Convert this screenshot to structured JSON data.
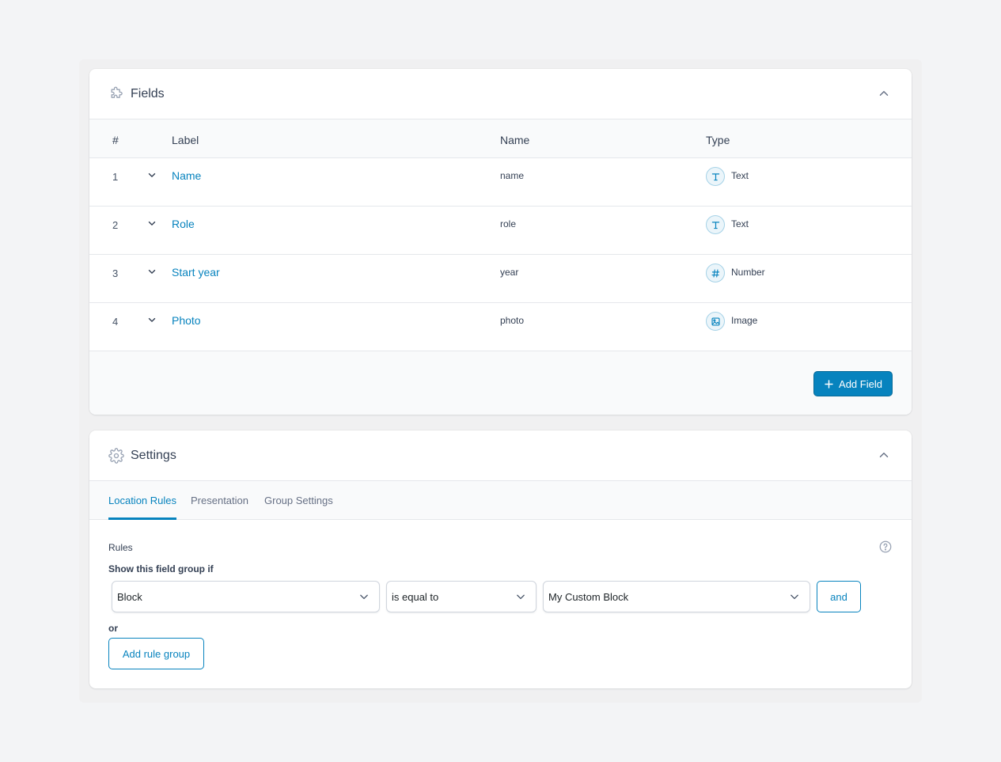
{
  "fields_panel": {
    "title": "Fields",
    "columns": {
      "num": "#",
      "label": "Label",
      "name": "Name",
      "type": "Type"
    },
    "rows": [
      {
        "num": "1",
        "label": "Name",
        "name": "name",
        "type": "Text",
        "type_icon": "text-icon"
      },
      {
        "num": "2",
        "label": "Role",
        "name": "role",
        "type": "Text",
        "type_icon": "text-icon"
      },
      {
        "num": "3",
        "label": "Start year",
        "name": "year",
        "type": "Number",
        "type_icon": "number-icon"
      },
      {
        "num": "4",
        "label": "Photo",
        "name": "photo",
        "type": "Image",
        "type_icon": "image-icon"
      }
    ],
    "add_field_label": "Add Field"
  },
  "settings_panel": {
    "title": "Settings",
    "tabs": [
      {
        "label": "Location Rules",
        "active": true
      },
      {
        "label": "Presentation",
        "active": false
      },
      {
        "label": "Group Settings",
        "active": false
      }
    ],
    "rules_title": "Rules",
    "show_if_label": "Show this field group if",
    "rule": {
      "param": "Block",
      "operator": "is equal to",
      "value": "My Custom Block"
    },
    "and_label": "and",
    "or_label": "or",
    "add_rule_group_label": "Add rule group"
  },
  "colors": {
    "accent": "#0783be",
    "page_bg": "#f3f4f6",
    "panel_bg": "#ffffff",
    "header_bg": "#f9fafb"
  }
}
